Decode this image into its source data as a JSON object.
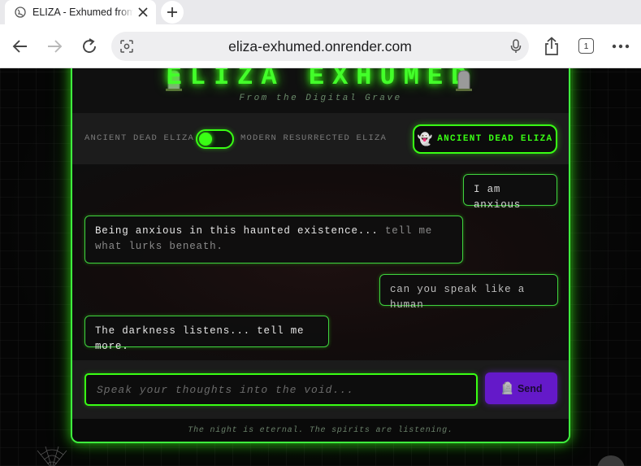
{
  "browser": {
    "tab_title": "ELIZA - Exhumed from the Digital Grave",
    "url": "eliza-exhumed.onrender.com",
    "tab_count": "1",
    "icons": {
      "favicon": "globe-icon",
      "close": "close-icon",
      "new_tab": "plus-icon",
      "back": "back-arrow-icon",
      "forward": "forward-arrow-icon",
      "reload": "reload-icon",
      "lens": "lens-icon",
      "mic": "microphone-icon",
      "share": "share-icon",
      "tabs": "tabs-icon",
      "more": "more-icon"
    }
  },
  "header": {
    "title": "ELIZA EXHUMED",
    "subtitle": "From the Digital Grave",
    "left_icon": "tombstone-icon",
    "right_icon": "tombstone-icon"
  },
  "mode": {
    "left_label": "ANCIENT DEAD ELIZA",
    "right_label": "MODERN RESURRECTED ELIZA",
    "toggle_state": "ancient",
    "button_icon": "👻",
    "button_label": "ANCIENT DEAD ELIZA"
  },
  "messages": [
    {
      "role": "user",
      "text": "I am anxious"
    },
    {
      "role": "eliza",
      "text": "Being anxious in this haunted existence... ",
      "faded_text": "tell me what lurks beneath."
    },
    {
      "role": "user",
      "text": "can you speak like a human"
    },
    {
      "role": "eliza",
      "text": "The darkness listens... tell me more."
    }
  ],
  "composer": {
    "placeholder": "Speak your thoughts into the void...",
    "value": "",
    "send_icon": "🪦",
    "send_label": "Send"
  },
  "footer": {
    "text": "The night is eternal. The spirits are listening."
  },
  "colors": {
    "neon_green": "#39ff14",
    "send_purple": "#6419c9",
    "panel_bg": "#121212"
  }
}
